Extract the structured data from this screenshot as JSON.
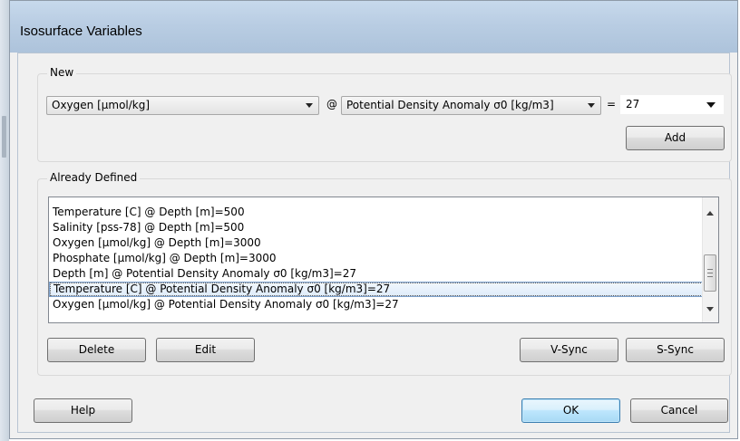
{
  "window": {
    "title": "Isosurface Variables"
  },
  "new_group": {
    "label": "New",
    "variable": "Oxygen [µmol/kg]",
    "at_symbol": "@",
    "surface_variable": "Potential Density Anomaly σ0 [kg/m3]",
    "equals_symbol": "=",
    "value": "27",
    "add_label": "Add"
  },
  "defined_group": {
    "label": "Already Defined",
    "items": [
      "Temperature [C] @ Depth [m]=500",
      "Salinity [pss-78] @ Depth [m]=500",
      "Oxygen [µmol/kg] @ Depth [m]=3000",
      "Phosphate [µmol/kg] @ Depth [m]=3000",
      "Depth [m] @ Potential Density Anomaly σ0 [kg/m3]=27",
      "Temperature [C] @ Potential Density Anomaly σ0 [kg/m3]=27",
      "Oxygen [µmol/kg] @ Potential Density Anomaly σ0 [kg/m3]=27"
    ],
    "selected_index": 5,
    "buttons": {
      "delete": "Delete",
      "edit": "Edit",
      "vsync": "V-Sync",
      "ssync": "S-Sync"
    }
  },
  "footer": {
    "help": "Help",
    "ok": "OK",
    "cancel": "Cancel"
  }
}
